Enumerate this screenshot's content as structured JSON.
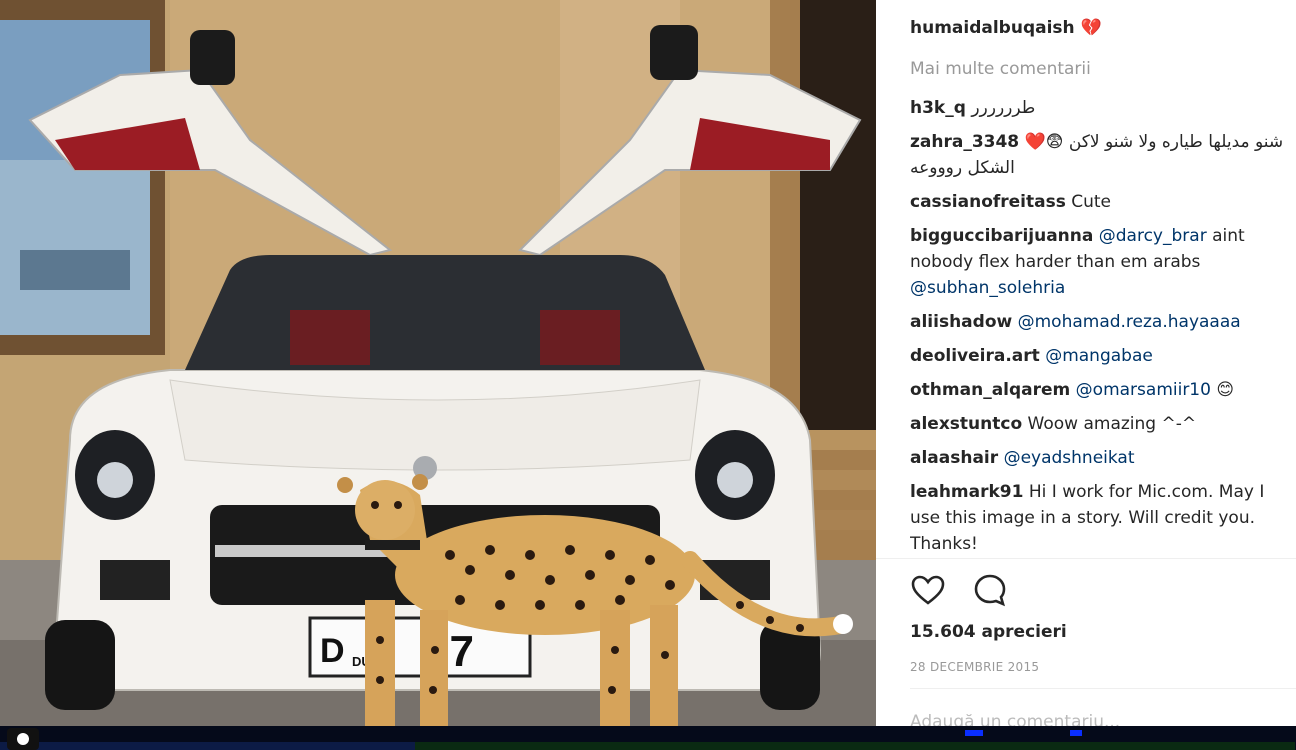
{
  "post": {
    "owner": "humaidalbuqaish",
    "owner_emoji": "💔",
    "more_comments": "Mai multe comentarii",
    "comments": [
      {
        "user": "h3k_q",
        "parts": [
          {
            "t": "text",
            "v": "طرررررر"
          }
        ]
      },
      {
        "user": "zahra_3348",
        "parts": [
          {
            "t": "text",
            "v": "❤️😨 شنو مديلها طياره ولا شنو لاكن الشكل روووعه"
          }
        ]
      },
      {
        "user": "cassianofreitass",
        "parts": [
          {
            "t": "text",
            "v": "Cute"
          }
        ]
      },
      {
        "user": "bigguccibarijuanna",
        "parts": [
          {
            "t": "mention",
            "v": "@darcy_brar"
          },
          {
            "t": "text",
            "v": " aint nobody flex harder than em arabs "
          },
          {
            "t": "mention",
            "v": "@subhan_solehria"
          }
        ]
      },
      {
        "user": "aliishadow",
        "parts": [
          {
            "t": "mention",
            "v": "@mohamad.reza.hayaaaa"
          }
        ]
      },
      {
        "user": "deoliveira.art",
        "parts": [
          {
            "t": "mention",
            "v": "@mangabae"
          }
        ]
      },
      {
        "user": "othman_alqarem",
        "parts": [
          {
            "t": "mention",
            "v": "@omarsamiir10"
          },
          {
            "t": "text",
            "v": " 😊"
          }
        ]
      },
      {
        "user": "alexstuntco",
        "parts": [
          {
            "t": "text",
            "v": "Woow amazing ^-^"
          }
        ]
      },
      {
        "user": "alaashair",
        "parts": [
          {
            "t": "mention",
            "v": "@eyadshneikat"
          }
        ]
      },
      {
        "user": "leahmark91",
        "parts": [
          {
            "t": "text",
            "v": "Hi I work for Mic.com. May I use this image in a story. Will credit you. Thanks!"
          }
        ]
      }
    ],
    "likes": "15.604 aprecieri",
    "date": "28 DECEMBRIE 2015",
    "add_comment_placeholder": "Adaugă un comentariu...",
    "license_plate": {
      "letter": "D",
      "city": "DUBAI",
      "number": "77"
    },
    "icons": {
      "like": "heart-icon",
      "comment": "comment-bubble-icon",
      "camera": "camera-icon"
    }
  },
  "colors": {
    "mention": "#003569",
    "muted": "#999999",
    "text": "#262626"
  }
}
